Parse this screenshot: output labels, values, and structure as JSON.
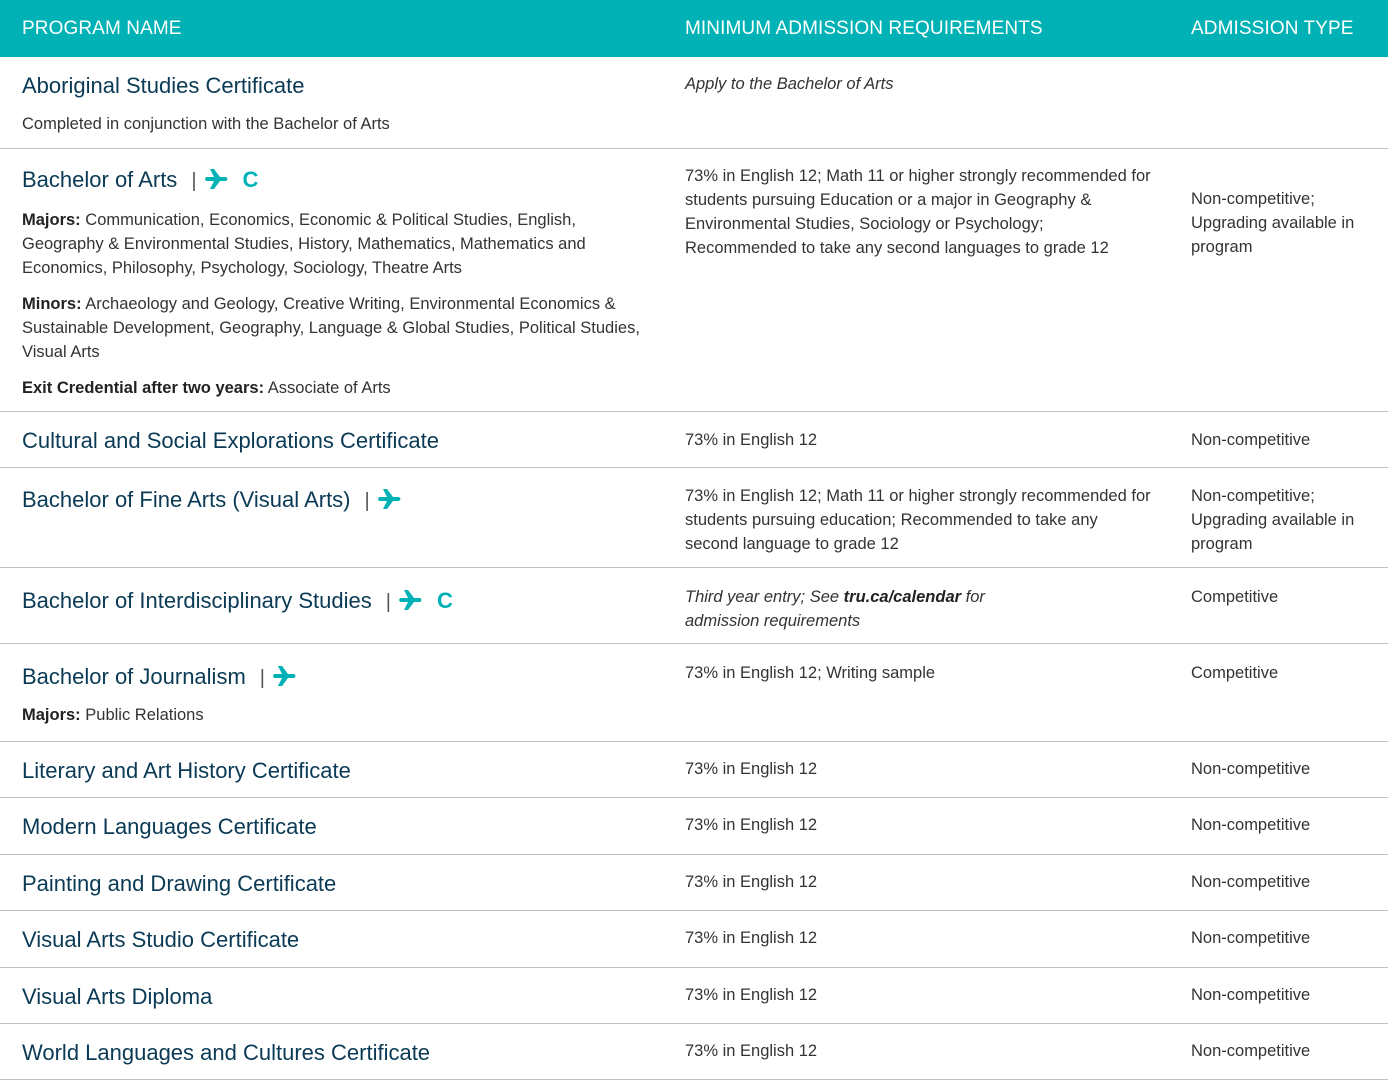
{
  "header": {
    "col1": "PROGRAM NAME",
    "col2": "MINIMUM ADMISSION REQUIREMENTS",
    "col3": "ADMISSION TYPE"
  },
  "accent_color": "#00b2b5",
  "rows": [
    {
      "name": "Aboriginal Studies Certificate",
      "note": "Completed in conjunction with the Bachelor of Arts",
      "requirements": "Apply to the Bachelor of Arts",
      "type": ""
    },
    {
      "name": "Bachelor of Arts",
      "icons": [
        "plane-icon",
        "c-icon"
      ],
      "majors_label": "Majors:",
      "majors": "Communication, Economics, Economic & Political Studies, English, Geography & Environmental Studies, History, Mathematics, Mathematics and Economics, Philosophy, Psychology, Sociology, Theatre Arts",
      "minors_label": "Minors:",
      "minors": "Archaeology and Geology, Creative Writing, Environmental Economics & Sustainable Development, Geography, Language & Global Studies, Political Studies, Visual Arts",
      "exit_label": "Exit Credential after two years:",
      "exit": "Associate of Arts",
      "requirements": "73% in English 12; Math 11 or higher strongly recommended for students pursuing Education or a major in Geography & Environmental Studies, Sociology or Psychology; Recommended to take any second languages to grade 12",
      "type": "Non-competitive; Upgrading available in program"
    },
    {
      "name": "Cultural and Social Explorations Certificate",
      "requirements": "73% in English 12",
      "type": "Non-competitive"
    },
    {
      "name": "Bachelor of Fine Arts (Visual Arts)",
      "icons": [
        "plane-icon"
      ],
      "requirements": "73% in English 12; Math 11 or higher strongly recommended for students pursuing education; Recommended to take any second language to grade 12",
      "type": "Non-competitive; Upgrading available in program"
    },
    {
      "name": "Bachelor of Interdisciplinary Studies",
      "icons": [
        "plane-icon",
        "c-icon"
      ],
      "requirements_pre": "Third year entry; See ",
      "requirements_link": "tru.ca/calendar",
      "requirements_post": " for admission requirements",
      "type": "Competitive"
    },
    {
      "name": "Bachelor of Journalism",
      "icons": [
        "plane-icon"
      ],
      "majors_label": "Majors:",
      "majors": "Public Relations",
      "requirements": "73% in English 12; Writing sample",
      "type": "Competitive"
    },
    {
      "name": "Literary and Art History Certificate",
      "requirements": "73% in English 12",
      "type": "Non-competitive"
    },
    {
      "name": "Modern Languages Certificate",
      "requirements": "73% in English 12",
      "type": "Non-competitive"
    },
    {
      "name": "Painting and Drawing Certificate",
      "requirements": "73% in English 12",
      "type": "Non-competitive"
    },
    {
      "name": "Visual Arts Studio Certificate",
      "requirements": "73% in English 12",
      "type": "Non-competitive"
    },
    {
      "name": "Visual Arts Diploma",
      "requirements": "73% in English 12",
      "type": "Non-competitive"
    },
    {
      "name": "World Languages and Cultures Certificate",
      "requirements": "73% in English 12",
      "type": "Non-competitive"
    }
  ],
  "icon_c_text": "C",
  "pipe_text": "|"
}
